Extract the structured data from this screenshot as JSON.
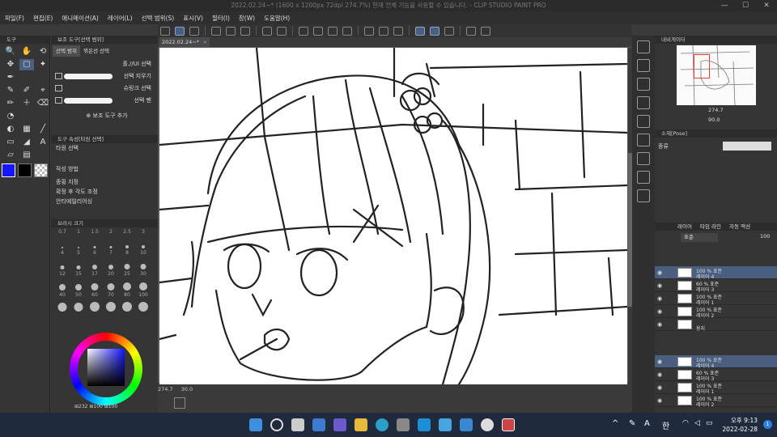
{
  "window": {
    "title": "2022.02.24~* (1600 x 1200px 72dpi 274.7%)  현재 전체 기능을 사용할 수 있습니다. - CLIP STUDIO PAINT PRO",
    "minimize": "—",
    "maximize": "☐",
    "close": "✕"
  },
  "menu": [
    "파일(F)",
    "편집(E)",
    "애니메이션(A)",
    "레이어(L)",
    "선택 범위(S)",
    "표시(V)",
    "필터(I)",
    "창(W)",
    "도움말(H)"
  ],
  "document_tab": {
    "label": "2022.02.24~*",
    "close": "×"
  },
  "tool_panel": {
    "title": "도구"
  },
  "tools": [
    "🔍",
    "✋",
    "⟲",
    "✥",
    "▢",
    "✦",
    "✒",
    "",
    "",
    "✎",
    "✐",
    "⌖",
    "✏",
    "＋",
    "⌫",
    "◔",
    "",
    "",
    "◐",
    "▦",
    "╱",
    "▭",
    "◢",
    "A",
    "▱",
    "▤",
    ""
  ],
  "sub_tool": {
    "title": "보조 도구[선택 범위]",
    "tabs": [
      "선택 범위",
      "꺾은선 선택"
    ],
    "items": [
      {
        "label": "홀.//UI 선택"
      },
      {
        "label": "선택 지우기"
      },
      {
        "label": "슈링크 선택"
      },
      {
        "label": "선택 펜"
      }
    ],
    "add_label": "보조 도구 추가"
  },
  "tool_property": {
    "title": "도구 속성[타원 선택]",
    "tool_name": "타원 선택",
    "rows": [
      {
        "label": "작성 방법"
      },
      {
        "label": "종횡 지정"
      },
      {
        "label": "확정 후 각도 조정"
      },
      {
        "label": "안티에일리어싱"
      }
    ]
  },
  "brush_size": {
    "title": "브러시 크기",
    "sizes": [
      "0.7",
      "1",
      "1.5",
      "2",
      "2.5",
      "3",
      "4",
      "5",
      "6",
      "7",
      "8",
      "10",
      "12",
      "15",
      "17",
      "20",
      "25",
      "30",
      "40",
      "50",
      "60",
      "70",
      "80",
      "100"
    ]
  },
  "color_values": {
    "h": "232",
    "s": "100",
    "v": "100",
    "label": "⊞232 ⊞100 ⊞100"
  },
  "colors": {
    "main": "#1515ff",
    "sub": "#000000",
    "accent": "#4a5f80"
  },
  "status": {
    "zoom": "274.7",
    "angle": "30.0"
  },
  "navigator": {
    "title": "내비게이터",
    "zoom": "274.7",
    "angle": "90.0"
  },
  "subview": {
    "title": "소재[Pose]",
    "field": "종류"
  },
  "layer_panel": {
    "tabs": [
      "레이어",
      "타임 라인",
      "자동 액션"
    ],
    "blend_mode": "표준",
    "opacity": "100",
    "layers": [
      {
        "line1": "100 % 표준",
        "line2": "레이어 4",
        "selected": true
      },
      {
        "line1": "60 % 표준",
        "line2": "레이어 3",
        "selected": false
      },
      {
        "line1": "100 % 표준",
        "line2": "레이어 1",
        "selected": false
      },
      {
        "line1": "100 % 표준",
        "line2": "레이어 2",
        "selected": false
      },
      {
        "line1": "",
        "line2": "용지",
        "selected": false
      }
    ],
    "layers_lower": [
      {
        "line1": "100 % 표준",
        "line2": "레이어 4",
        "selected": true
      },
      {
        "line1": "60 % 표준",
        "line2": "레이어 3",
        "selected": false
      },
      {
        "line1": "100 % 표준",
        "line2": "레이어 1",
        "selected": false
      },
      {
        "line1": "100 % 표준",
        "line2": "레이어 2",
        "selected": false
      }
    ]
  },
  "taskbar": {
    "tray_a": "A",
    "tray_han": "한",
    "time": "오후 9:13",
    "date": "2022-02-28",
    "notifications": "1",
    "apps": [
      "windows-start-icon",
      "search-icon",
      "task-view-icon",
      "widgets-icon",
      "teams-icon",
      "file-explorer-icon",
      "edge-icon",
      "store-icon",
      "app-icon",
      "app-icon",
      "app-icon",
      "app-icon",
      "clip-studio-icon"
    ]
  }
}
